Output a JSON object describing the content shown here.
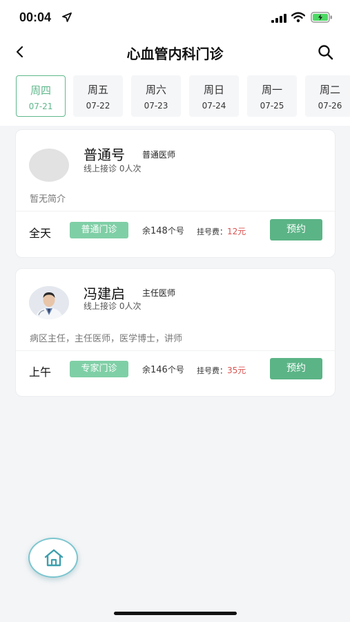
{
  "status_bar": {
    "time": "00:04"
  },
  "nav": {
    "title": "心血管内科门诊"
  },
  "dates": [
    {
      "dow": "周四",
      "date": "07-21",
      "active": true
    },
    {
      "dow": "周五",
      "date": "07-22",
      "active": false
    },
    {
      "dow": "周六",
      "date": "07-23",
      "active": false
    },
    {
      "dow": "周日",
      "date": "07-24",
      "active": false
    },
    {
      "dow": "周一",
      "date": "07-25",
      "active": false
    },
    {
      "dow": "周二",
      "date": "07-26",
      "active": false
    }
  ],
  "doctors": [
    {
      "name": "普通号",
      "title": "普通医师",
      "stat": "线上接诊 0人次",
      "intro": "暂无简介",
      "slot_time": "全天",
      "slot_type": "普通门诊",
      "remain_prefix": "余",
      "remain_count": "148",
      "remain_suffix": "个号",
      "fee_label": "挂号费：",
      "fee_value": "12元",
      "book_label": "预约"
    },
    {
      "name": "冯建启",
      "title": "主任医师",
      "stat": "线上接诊 0人次",
      "intro": "病区主任，主任医师，医学博士，讲师",
      "slot_time": "上午",
      "slot_type": "专家门诊",
      "remain_prefix": "余",
      "remain_count": "146",
      "remain_suffix": "个号",
      "fee_label": "挂号费：",
      "fee_value": "35元",
      "book_label": "预约"
    }
  ],
  "colors": {
    "accent": "#5bb486",
    "tag": "#7fcfa6",
    "fee": "#d9534f"
  },
  "icons": {
    "back": "chevron-left-icon",
    "search": "search-icon",
    "home": "home-icon"
  }
}
